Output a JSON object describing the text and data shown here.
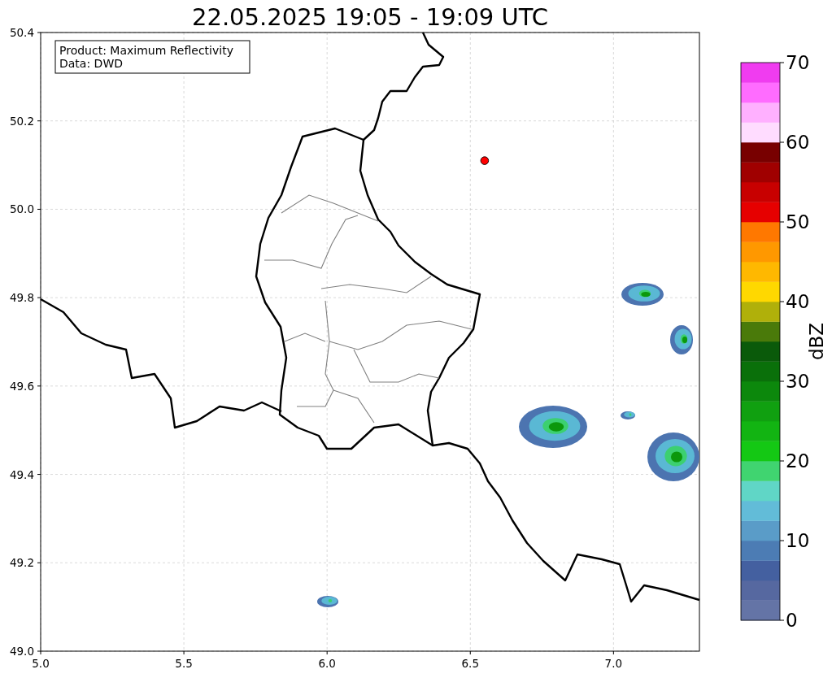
{
  "map": {
    "chart_data": {
      "type": "scatter",
      "title": "22.05.2025 19:05 - 19:09 UTC",
      "x": [
        6.55
      ],
      "series": [
        {
          "color": "#ff0000",
          "values": [
            50.11
          ]
        }
      ],
      "grid": true,
      "xlim": [
        5.0,
        7.3
      ],
      "ylim": [
        49.0,
        50.4
      ],
      "xticks": [
        {
          "value": 5.0,
          "label": "5.0"
        },
        {
          "value": 5.5,
          "label": "5.5"
        },
        {
          "value": 6.0,
          "label": "6.0"
        },
        {
          "value": 6.5,
          "label": "6.5"
        },
        {
          "value": 7.0,
          "label": "7.0"
        }
      ],
      "yticks": [
        {
          "value": 49.0,
          "label": "49.0"
        },
        {
          "value": 49.2,
          "label": "49.2"
        },
        {
          "value": 49.4,
          "label": "49.4"
        },
        {
          "value": 49.6,
          "label": "49.6"
        },
        {
          "value": 49.8,
          "label": "49.8"
        },
        {
          "value": 50.0,
          "label": "50.0"
        },
        {
          "value": 50.2,
          "label": "50.2"
        },
        {
          "value": 50.4,
          "label": "50.4"
        }
      ]
    },
    "info_box": {
      "lines": [
        "Product: Maximum Reflectivity",
        "Data: DWD"
      ]
    }
  },
  "colorbar": {
    "label": "dBZ",
    "ticks": [
      "70",
      "60",
      "50",
      "40",
      "30",
      "20",
      "10",
      "0"
    ],
    "segments": [
      {
        "color": "#6474a6"
      },
      {
        "color": "#5668a0"
      },
      {
        "color": "#4460a0"
      },
      {
        "color": "#4c7cb4"
      },
      {
        "color": "#5a9cc8"
      },
      {
        "color": "#62bcd8"
      },
      {
        "color": "#60d6c6"
      },
      {
        "color": "#40d470"
      },
      {
        "color": "#14c814"
      },
      {
        "color": "#12b412"
      },
      {
        "color": "#10a010"
      },
      {
        "color": "#0c880c"
      },
      {
        "color": "#0a700a"
      },
      {
        "color": "#0a5a0a"
      },
      {
        "color": "#4a7a0a"
      },
      {
        "color": "#b0b00a"
      },
      {
        "color": "#ffd800"
      },
      {
        "color": "#ffb800"
      },
      {
        "color": "#ff9800"
      },
      {
        "color": "#ff7800"
      },
      {
        "color": "#e60000"
      },
      {
        "color": "#c80000"
      },
      {
        "color": "#a00000"
      },
      {
        "color": "#780000"
      },
      {
        "color": "#ffdcff"
      },
      {
        "color": "#ffb0ff"
      },
      {
        "color": "#ff6cff"
      },
      {
        "color": "#f03cf0"
      }
    ]
  }
}
